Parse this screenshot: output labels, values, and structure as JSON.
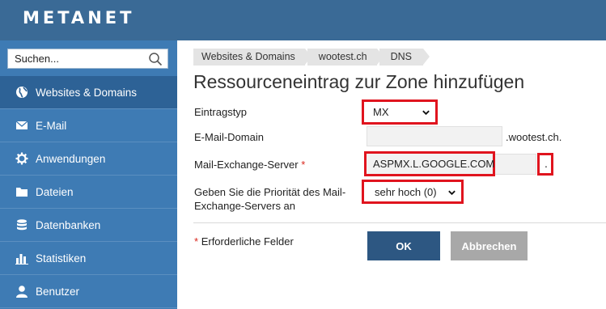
{
  "header": {
    "logo_text": "METANET"
  },
  "sidebar": {
    "search_placeholder": "Suchen...",
    "items": [
      {
        "label": "Websites & Domains",
        "icon": "globe-icon",
        "active": true
      },
      {
        "label": "E-Mail",
        "icon": "mail-icon"
      },
      {
        "label": "Anwendungen",
        "icon": "gear-icon"
      },
      {
        "label": "Dateien",
        "icon": "folder-icon"
      },
      {
        "label": "Datenbanken",
        "icon": "database-icon"
      },
      {
        "label": "Statistiken",
        "icon": "bar-chart-icon"
      },
      {
        "label": "Benutzer",
        "icon": "user-icon"
      }
    ]
  },
  "breadcrumb": [
    "Websites & Domains",
    "wootest.ch",
    "DNS"
  ],
  "page": {
    "title": "Ressourceneintrag zur Zone hinzufügen"
  },
  "form": {
    "type_label": "Eintragstyp",
    "type_value": "MX",
    "domain_label": "E-Mail-Domain",
    "domain_value": "",
    "domain_suffix": ".wootest.ch.",
    "server_label": "Mail-Exchange-Server",
    "required_mark": "*",
    "server_value": "ASPMX.L.GOOGLE.COM",
    "server_suffix": ".",
    "priority_label_line1": "Geben Sie die Priorität des Mail-",
    "priority_label_line2": "Exchange-Servers an",
    "priority_value": "sehr hoch (0)",
    "required_note": "Erforderliche Felder",
    "ok_label": "OK",
    "cancel_label": "Abbrechen"
  },
  "colors": {
    "header_bg": "#3a6a96",
    "sidebar_bg": "#3e7bb4",
    "sidebar_active_bg": "#2d6296",
    "highlight": "#e0141e",
    "ok_button": "#2d5782",
    "cancel_button": "#a8a8a8",
    "required": "#d9261c"
  }
}
